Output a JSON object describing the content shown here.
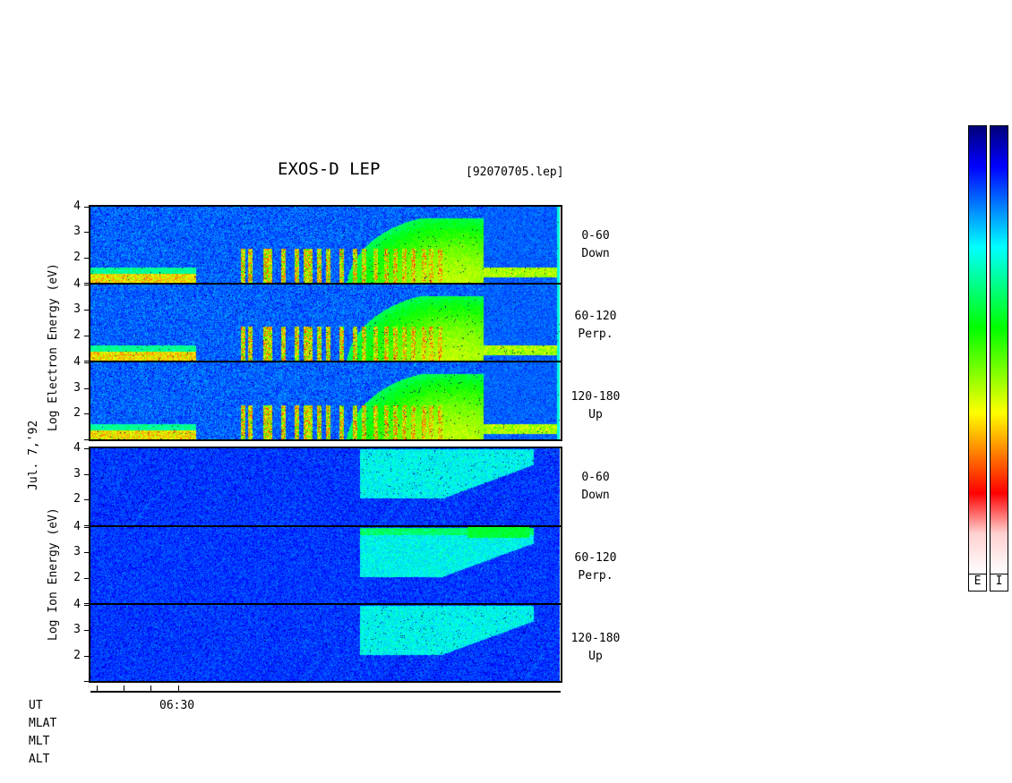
{
  "title": "EXOS-D LEP",
  "file_label": "[92070705.lep]",
  "date_label": "Jul. 7,'92",
  "electron_axis_label": "Log Electron Energy (eV)",
  "ion_axis_label": "Log Ion Energy (eV)",
  "channels": [
    {
      "range": "0-60",
      "dir": "Down"
    },
    {
      "range": "60-120",
      "dir": "Perp."
    },
    {
      "range": "120-180",
      "dir": "Up"
    },
    {
      "range": "0-60",
      "dir": "Down"
    },
    {
      "range": "60-120",
      "dir": "Perp."
    },
    {
      "range": "120-180",
      "dir": "Up"
    }
  ],
  "footer_labels": [
    "UT",
    "MLAT",
    "MLT",
    "ALT"
  ],
  "colorbar_labels": [
    "E",
    "I"
  ],
  "colors": {
    "background": "#0000a8",
    "frame": "#000000"
  },
  "chart_data": {
    "type": "heatmap",
    "title": "EXOS-D LEP",
    "y_axis": "Log Energy (eV)",
    "yticks": [
      "4",
      "3",
      "2"
    ],
    "x_tick_labels": [
      "06:30"
    ],
    "panels": [
      {
        "species": "Electron",
        "pitch_angle": "0-60",
        "direction": "Down",
        "ylim": [
          1,
          4
        ]
      },
      {
        "species": "Electron",
        "pitch_angle": "60-120",
        "direction": "Perp.",
        "ylim": [
          1,
          4
        ]
      },
      {
        "species": "Electron",
        "pitch_angle": "120-180",
        "direction": "Up",
        "ylim": [
          1,
          4
        ]
      },
      {
        "species": "Ion",
        "pitch_angle": "0-60",
        "direction": "Down",
        "ylim": [
          1,
          4
        ]
      },
      {
        "species": "Ion",
        "pitch_angle": "60-120",
        "direction": "Perp.",
        "ylim": [
          1,
          4
        ]
      },
      {
        "species": "Ion",
        "pitch_angle": "120-180",
        "direction": "Up",
        "ylim": [
          1,
          4
        ]
      }
    ],
    "colorbars": [
      "E",
      "I"
    ],
    "colorscale": [
      "#00007a",
      "#0000ff",
      "#0080ff",
      "#00ffff",
      "#00ff80",
      "#00ff00",
      "#80ff00",
      "#ffff00",
      "#ff8000",
      "#ff0000",
      "#ffd0d0",
      "#ffffff"
    ]
  }
}
